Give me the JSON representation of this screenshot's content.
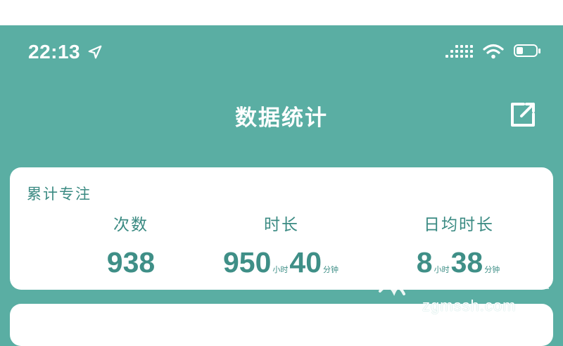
{
  "status_bar": {
    "time": "22:13",
    "icons": [
      "location-arrow-icon",
      "signal-icon",
      "wifi-icon",
      "battery-icon"
    ],
    "battery_level": 0.35
  },
  "nav": {
    "title": "数据统计",
    "share_icon": "share-icon"
  },
  "summary_card": {
    "title": "累计专注",
    "count": {
      "label": "次数",
      "value": "938"
    },
    "duration": {
      "label": "时长",
      "hours": "950",
      "hours_unit": "小时",
      "minutes": "40",
      "minutes_unit": "分钟"
    },
    "daily_avg": {
      "label": "日均时长",
      "hours": "8",
      "hours_unit": "小时",
      "minutes": "38",
      "minutes_unit": "分钟"
    }
  },
  "watermark": {
    "text": "zgmssh.com"
  },
  "colors": {
    "header": "#5aaea3",
    "accent": "#3a8a82",
    "card": "#ffffff"
  }
}
